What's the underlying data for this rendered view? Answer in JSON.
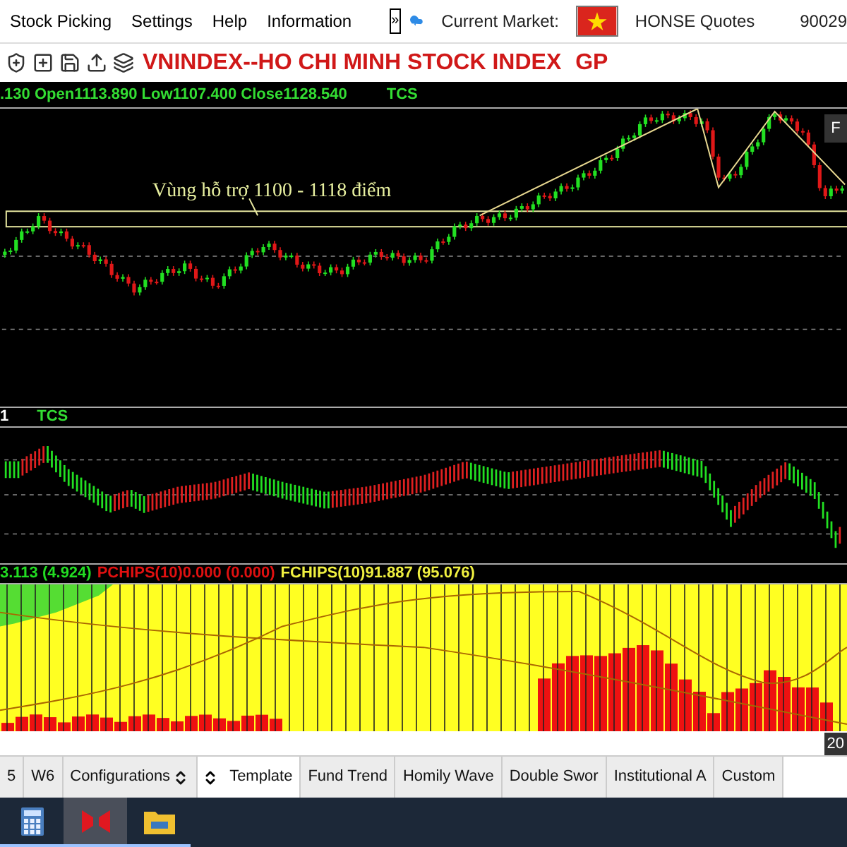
{
  "menu": [
    {
      "label": "Stock Picking"
    },
    {
      "label": "Settings"
    },
    {
      "label": "Help"
    },
    {
      "label": "Information"
    }
  ],
  "expand_button": "»",
  "market": {
    "label": "Current Market:",
    "quotes": "HONSE Quotes",
    "number": "90029"
  },
  "title": {
    "name": "VNINDEX--HO CHI MINH STOCK INDEX",
    "suffix": "GP"
  },
  "price_header": {
    "ohlc": ".130 Open1113.890 Low1107.400 Close1128.540",
    "code": "TCS"
  },
  "annotation": "Vùng hỗ trợ 1100 - 1118 điểm",
  "corner_button": "F",
  "macd": {
    "label": "1",
    "code": "TCS"
  },
  "chips": [
    {
      "text": "3.113 (4.924)",
      "color": "#22dd22"
    },
    {
      "text": "PCHIPS(10)0.000 (0.000)",
      "color": "#e01010"
    },
    {
      "text": "FCHIPS(10)91.887 (95.076)",
      "color": "#f0f040"
    }
  ],
  "date_label": "20",
  "tabs": [
    {
      "label": "5",
      "kind": "tab",
      "selected": false
    },
    {
      "label": "W6",
      "kind": "tab",
      "selected": false
    },
    {
      "label": "Configurations",
      "kind": "spinner-tab",
      "selected": false
    },
    {
      "label": "Template",
      "kind": "tab",
      "selected": true
    },
    {
      "label": "Fund Trend",
      "kind": "tab",
      "selected": false
    },
    {
      "label": "Homily Wave",
      "kind": "tab",
      "selected": false
    },
    {
      "label": "Double Swor",
      "kind": "tab",
      "selected": false
    },
    {
      "label": "Institutional A",
      "kind": "tab",
      "selected": false
    },
    {
      "label": "Custom",
      "kind": "tab",
      "selected": false
    }
  ],
  "taskbar": [
    {
      "kind": "calculator",
      "selected": false
    },
    {
      "kind": "app",
      "selected": true
    },
    {
      "kind": "folder",
      "selected": false
    }
  ]
}
